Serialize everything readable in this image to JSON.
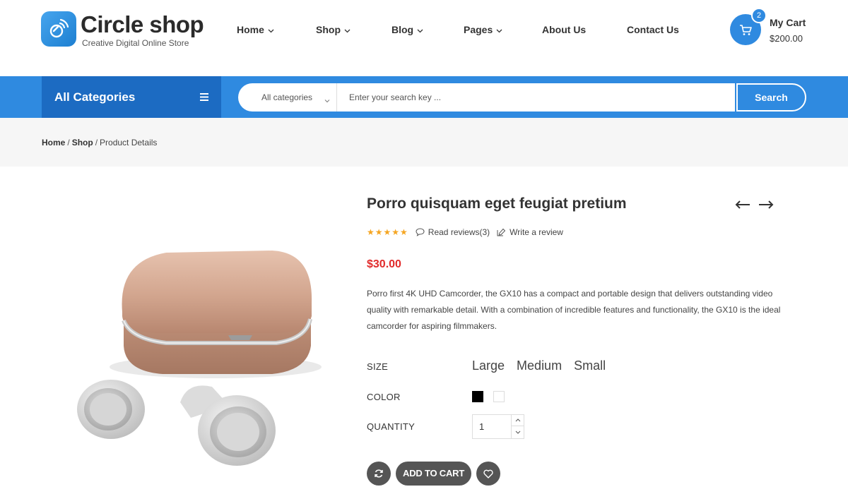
{
  "brand": {
    "name": "Circle shop",
    "tagline": "Creative Digital Online Store",
    "accent": "#2f8ae0",
    "accent_dark": "#1c6bc2"
  },
  "nav": {
    "items": [
      {
        "label": "Home",
        "has_dropdown": true
      },
      {
        "label": "Shop",
        "has_dropdown": true
      },
      {
        "label": "Blog",
        "has_dropdown": true
      },
      {
        "label": "Pages",
        "has_dropdown": true
      },
      {
        "label": "About Us",
        "has_dropdown": false
      },
      {
        "label": "Contact Us",
        "has_dropdown": false
      }
    ]
  },
  "cart": {
    "label": "My Cart",
    "total": "$200.00",
    "count": "2"
  },
  "category_bar": {
    "label": "All Categories",
    "menu_icon": "hamburger-icon"
  },
  "search": {
    "category_selected": "All categories",
    "placeholder": "Enter your search key ...",
    "button_label": "Search"
  },
  "breadcrumb": {
    "items": [
      "Home",
      "Shop",
      "Product Details"
    ],
    "separator": "/"
  },
  "product": {
    "title": "Porro quisquam eget feugiat pretium",
    "rating_stars": 5,
    "read_reviews": "Read reviews(3)",
    "write_review": "Write a review",
    "price": "$30.00",
    "description": "Porro first 4K UHD Camcorder, the GX10 has a compact and portable design that delivers outstanding video quality with remarkable detail. With a combination of incredible features and functionality, the GX10 is the ideal camcorder for aspiring filmmakers.",
    "image_icon": "earbuds-product-image"
  },
  "options": {
    "size_label": "SIZE",
    "sizes": [
      "Large",
      "Medium",
      "Small"
    ],
    "color_label": "COLOR",
    "colors": [
      "#000000",
      "#ffffff"
    ],
    "quantity_label": "QUANTITY",
    "quantity": "1"
  },
  "actions": {
    "add_to_cart": "ADD TO CART",
    "compare_icon": "refresh-icon",
    "wishlist_icon": "heart-icon"
  }
}
